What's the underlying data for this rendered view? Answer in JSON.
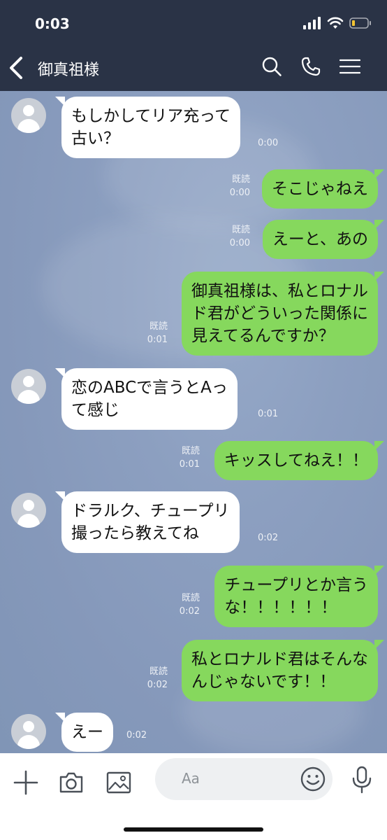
{
  "status": {
    "time": "0:03"
  },
  "header": {
    "title": "御真祖様"
  },
  "messages": [
    {
      "side": "recv",
      "text": "もしかしてリア充って\n古い？",
      "time": "0:00"
    },
    {
      "side": "sent",
      "text": "そこじゃねえ",
      "read": "既読",
      "time": "0:00"
    },
    {
      "side": "sent",
      "text": "えーと、あの",
      "read": "既読",
      "time": "0:00"
    },
    {
      "side": "sent",
      "text": "御真祖様は、私とロナル\nド君がどういった関係に\n見えてるんですか？",
      "read": "既読",
      "time": "0:01"
    },
    {
      "side": "recv",
      "text": "恋のABCで言うとAっ\nて感じ",
      "time": "0:01"
    },
    {
      "side": "sent",
      "text": "キッスしてねえ！！",
      "read": "既読",
      "time": "0:01"
    },
    {
      "side": "recv",
      "text": "ドラルク、チュープリ\n撮ったら教えてね",
      "time": "0:02"
    },
    {
      "side": "sent",
      "text": "チュープリとか言う\nな！！！！！！",
      "read": "既読",
      "time": "0:02"
    },
    {
      "side": "sent",
      "text": "私とロナルド君はそんな\nんじゃないです！！",
      "read": "既読",
      "time": "0:02"
    },
    {
      "side": "recv",
      "text": "えー",
      "time": "0:02"
    }
  ],
  "input": {
    "placeholder": "Aa"
  },
  "colors": {
    "header_bg": "#2a3346",
    "sent_bubble": "#86d85d",
    "recv_bubble": "#ffffff",
    "chat_bg": "#8c9fc0"
  }
}
